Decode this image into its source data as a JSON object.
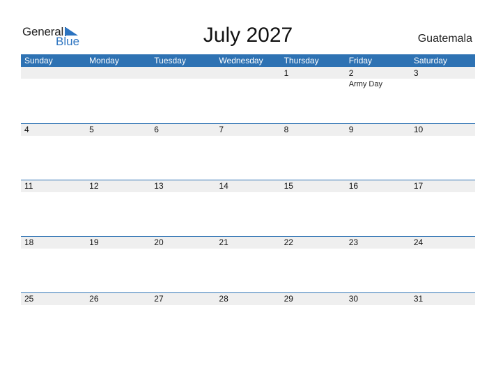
{
  "logo": {
    "general": "General",
    "blue": "Blue"
  },
  "title": "July 2027",
  "country": "Guatemala",
  "colors": {
    "accent": "#2e72b3",
    "day_bar": "#efefef"
  },
  "weekdays": [
    "Sunday",
    "Monday",
    "Tuesday",
    "Wednesday",
    "Thursday",
    "Friday",
    "Saturday"
  ],
  "weeks": [
    [
      {
        "day": ""
      },
      {
        "day": ""
      },
      {
        "day": ""
      },
      {
        "day": ""
      },
      {
        "day": "1"
      },
      {
        "day": "2",
        "event": "Army Day"
      },
      {
        "day": "3"
      }
    ],
    [
      {
        "day": "4"
      },
      {
        "day": "5"
      },
      {
        "day": "6"
      },
      {
        "day": "7"
      },
      {
        "day": "8"
      },
      {
        "day": "9"
      },
      {
        "day": "10"
      }
    ],
    [
      {
        "day": "11"
      },
      {
        "day": "12"
      },
      {
        "day": "13"
      },
      {
        "day": "14"
      },
      {
        "day": "15"
      },
      {
        "day": "16"
      },
      {
        "day": "17"
      }
    ],
    [
      {
        "day": "18"
      },
      {
        "day": "19"
      },
      {
        "day": "20"
      },
      {
        "day": "21"
      },
      {
        "day": "22"
      },
      {
        "day": "23"
      },
      {
        "day": "24"
      }
    ],
    [
      {
        "day": "25"
      },
      {
        "day": "26"
      },
      {
        "day": "27"
      },
      {
        "day": "28"
      },
      {
        "day": "29"
      },
      {
        "day": "30"
      },
      {
        "day": "31"
      }
    ]
  ]
}
